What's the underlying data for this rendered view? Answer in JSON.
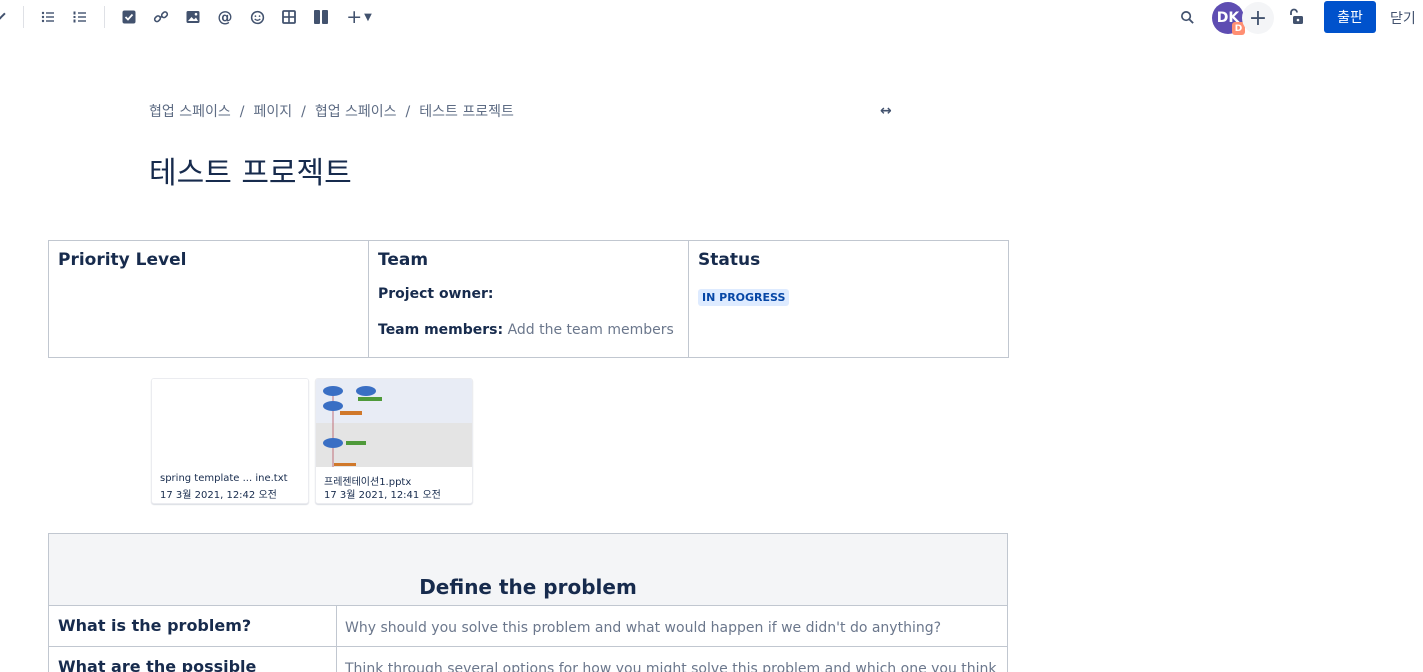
{
  "toolbar": {
    "icons": [
      "chevron-down-icon",
      "bullet-list-icon",
      "numbered-list-icon",
      "task-icon",
      "link-icon",
      "image-icon",
      "mention-icon",
      "emoji-icon",
      "table-icon",
      "layout-icon",
      "insert-more-icon",
      "search-icon",
      "lock-icon"
    ],
    "insert_label": "+",
    "avatar_initials": "DK",
    "avatar_badge": "D",
    "invite_label": "+",
    "publish_label": "출판",
    "close_label": "닫기",
    "colors": {
      "publish": "#0052cc",
      "avatar": "#5e4db2",
      "badge": "#ff8f73"
    }
  },
  "breadcrumb": [
    "협업 스페이스",
    "페이지",
    "협업 스페이스",
    "테스트 프로젝트"
  ],
  "breadcrumb_sep": "/",
  "page": {
    "title": "테스트 프로젝트",
    "expand_icon": "↔"
  },
  "info_table": {
    "priority_header": "Priority Level",
    "team_header": "Team",
    "project_owner_label": "Project owner:",
    "team_members_label": "Team members:",
    "team_members_placeholder": "Add the team members",
    "status_header": "Status",
    "status_value": "IN PROGRESS"
  },
  "attachments": [
    {
      "name": "spring template ... ine.txt",
      "date": "17 3월 2021, 12:42 오전"
    },
    {
      "name": "프레젠테이션1.pptx",
      "date": "17 3월 2021, 12:41 오전"
    }
  ],
  "problem_table": {
    "heading": "Define the problem",
    "rows": [
      {
        "label": "What is the problem?",
        "text": "Why should you solve this problem and what would happen if we didn't do anything?"
      },
      {
        "label": "What are the possible",
        "text": "Think through several options for how you might solve this problem and which one you think"
      }
    ]
  }
}
